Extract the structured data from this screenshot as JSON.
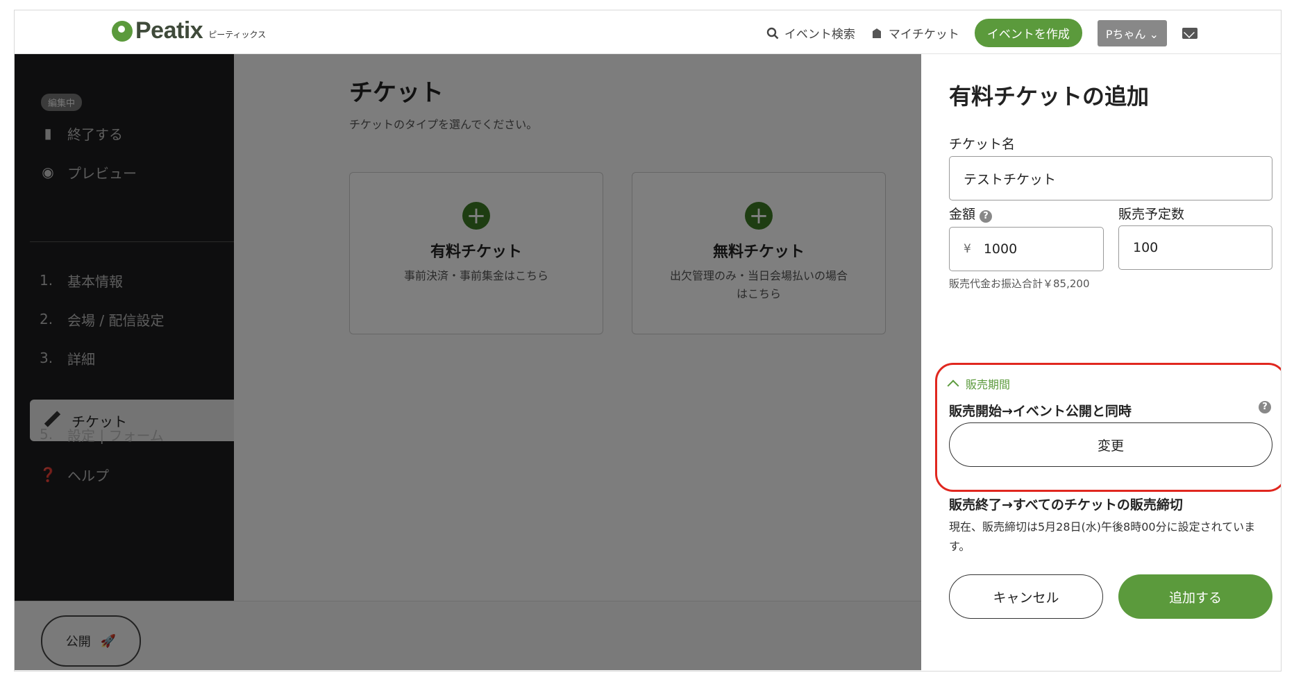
{
  "header": {
    "brand": "Peatix",
    "brand_sub": "ピーティックス",
    "nav": {
      "search": "イベント検索",
      "my_tickets": "マイチケット",
      "create_event": "イベントを作成",
      "user": "Pちゃん"
    }
  },
  "sidebar": {
    "badge": "編集中",
    "exit": "終了する",
    "preview": "プレビュー",
    "steps": [
      {
        "num": "1.",
        "label": "基本情報"
      },
      {
        "num": "2.",
        "label": "会場 / 配信設定"
      },
      {
        "num": "3.",
        "label": "詳細"
      },
      {
        "num": "",
        "label": "チケット"
      },
      {
        "num": "5.",
        "label": "設定 | フォーム"
      }
    ],
    "help": "ヘルプ",
    "publish": "公開"
  },
  "main": {
    "title": "チケット",
    "subtitle": "チケットのタイプを選んでください。",
    "cards": [
      {
        "title": "有料チケット",
        "desc": "事前決済・事前集金はこちら"
      },
      {
        "title": "無料チケット",
        "desc": "出欠管理のみ・当日会場払いの場合はこちら"
      }
    ]
  },
  "panel": {
    "title": "有料チケットの追加",
    "ticket_name_label": "チケット名",
    "ticket_name_value": "テストチケット",
    "price_label": "金額",
    "currency": "¥",
    "price_value": "1000",
    "quantity_label": "販売予定数",
    "quantity_value": "100",
    "total_note": "販売代金お振込合計￥85,200",
    "period_label": "販売期間",
    "start_text": "販売開始→イベント公開と同時",
    "change_button": "変更",
    "end_text": "販売終了→すべてのチケットの販売締切",
    "deadline_note": "現在、販売締切は5月28日(水)午後8時00分に設定されています。",
    "cancel_button": "キャンセル",
    "add_button": "追加する"
  }
}
